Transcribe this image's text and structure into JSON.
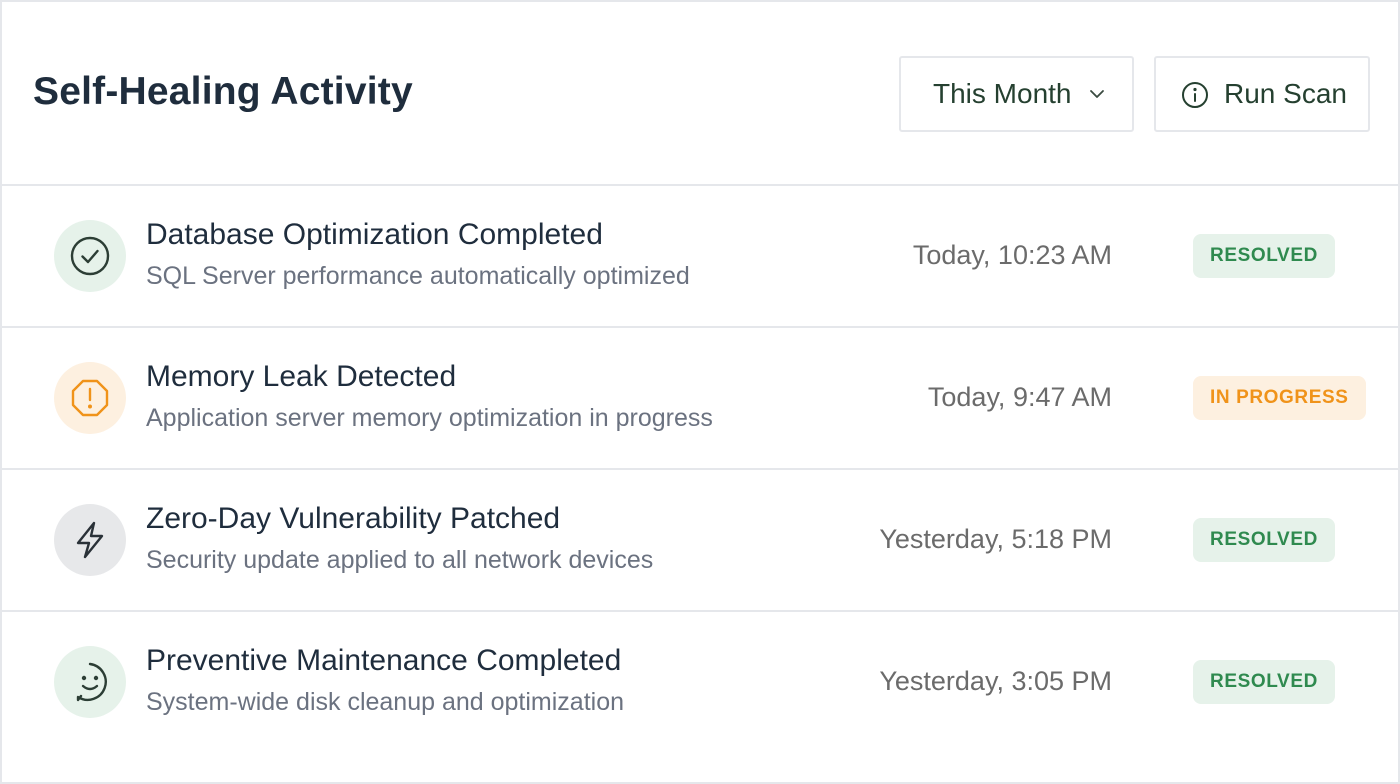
{
  "header": {
    "title": "Self-Healing Activity",
    "period_button": {
      "label": "This Month",
      "icon": "chevron-down-icon"
    },
    "scan_button": {
      "label": "Run Scan",
      "icon": "info-icon"
    }
  },
  "colors": {
    "resolved_text": "#2f8a4f",
    "resolved_bg": "#e6f2ea",
    "progress_text": "#f0931a",
    "progress_bg": "#fdf0e0",
    "neutral_icon_bg": "#e7e8ea"
  },
  "activities": [
    {
      "title": "Database Optimization Completed",
      "subtitle": "SQL Server performance automatically optimized",
      "time": "Today, 10:23 AM",
      "status": "RESOLVED",
      "icon": "check-circle-icon"
    },
    {
      "title": "Memory Leak Detected",
      "subtitle": "Application server memory optimization in progress",
      "time": "Today, 9:47 AM",
      "status": "IN PROGRESS",
      "icon": "alert-octagon-icon"
    },
    {
      "title": "Zero-Day Vulnerability Patched",
      "subtitle": "Security update applied to all network devices",
      "time": "Yesterday, 5:18 PM",
      "status": "RESOLVED",
      "icon": "lightning-icon"
    },
    {
      "title": "Preventive Maintenance Completed",
      "subtitle": "System-wide disk cleanup and optimization",
      "time": "Yesterday, 3:05 PM",
      "status": "RESOLVED",
      "icon": "smile-icon"
    }
  ]
}
